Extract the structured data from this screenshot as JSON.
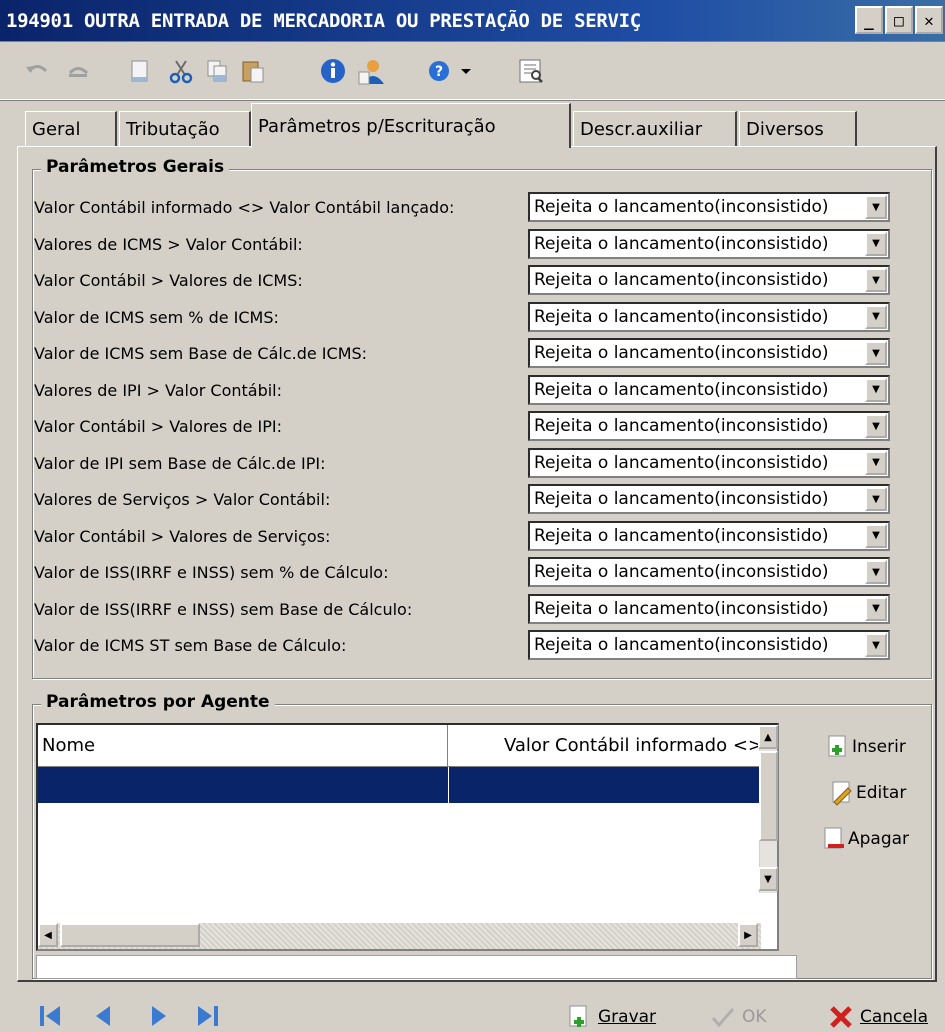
{
  "window": {
    "title": "194901 OUTRA ENTRADA DE MERCADORIA OU PRESTAÇÃO DE SERVIÇ",
    "minimize": "_",
    "maximize": "□",
    "close": "✕"
  },
  "toolbar": {
    "icons": [
      "undo-icon",
      "redo-icon",
      "new-document-icon",
      "cut-icon",
      "copy-icon",
      "paste-icon",
      "info-icon",
      "user-icon",
      "help-icon",
      "dropdown-icon",
      "print-preview-icon"
    ]
  },
  "tabs": [
    {
      "label": "Geral"
    },
    {
      "label": "Tributação"
    },
    {
      "label": "Parâmetros p/Escrituração"
    },
    {
      "label": "Descr.auxiliar"
    },
    {
      "label": "Diversos"
    }
  ],
  "params_gerais": {
    "title": "Parâmetros Gerais",
    "rows": [
      {
        "label": "Valor Contábil informado <> Valor Contábil lançado:",
        "value": "Rejeita o lancamento(inconsistido)"
      },
      {
        "label": "Valores de ICMS > Valor Contábil:",
        "value": "Rejeita o lancamento(inconsistido)"
      },
      {
        "label": "Valor Contábil > Valores de ICMS:",
        "value": "Rejeita o lancamento(inconsistido)"
      },
      {
        "label": "Valor de ICMS sem % de ICMS:",
        "value": "Rejeita o lancamento(inconsistido)"
      },
      {
        "label": "Valor de ICMS sem Base de Cálc.de ICMS:",
        "value": "Rejeita o lancamento(inconsistido)"
      },
      {
        "label": "Valores de IPI > Valor Contábil:",
        "value": "Rejeita o lancamento(inconsistido)"
      },
      {
        "label": "Valor Contábil > Valores de IPI:",
        "value": "Rejeita o lancamento(inconsistido)"
      },
      {
        "label": "Valor de IPI sem Base de Cálc.de IPI:",
        "value": "Rejeita o lancamento(inconsistido)"
      },
      {
        "label": "Valores de Serviços > Valor Contábil:",
        "value": "Rejeita o lancamento(inconsistido)"
      },
      {
        "label": "Valor Contábil > Valores de Serviços:",
        "value": "Rejeita o lancamento(inconsistido)"
      },
      {
        "label": "Valor de ISS(IRRF e INSS) sem % de Cálculo:",
        "value": "Rejeita o lancamento(inconsistido)"
      },
      {
        "label": "Valor de ISS(IRRF e INSS) sem Base de Cálculo:",
        "value": "Rejeita o lancamento(inconsistido)"
      },
      {
        "label": "Valor de ICMS ST sem Base de Cálculo:",
        "value": "Rejeita o lancamento(inconsistido)"
      }
    ]
  },
  "params_agente": {
    "title": "Parâmetros por Agente",
    "columns": [
      "Nome",
      "Valor Contábil informado <>"
    ],
    "buttons": {
      "insert": "Inserir",
      "edit": "Editar",
      "delete": "Apagar"
    }
  },
  "footer": {
    "save": "Gravar",
    "ok": "OK",
    "cancel": "Cancela"
  },
  "colors": {
    "selection": "#0a246a",
    "title_bar": "#0a246a",
    "window_bg": "#d4d0c8"
  }
}
